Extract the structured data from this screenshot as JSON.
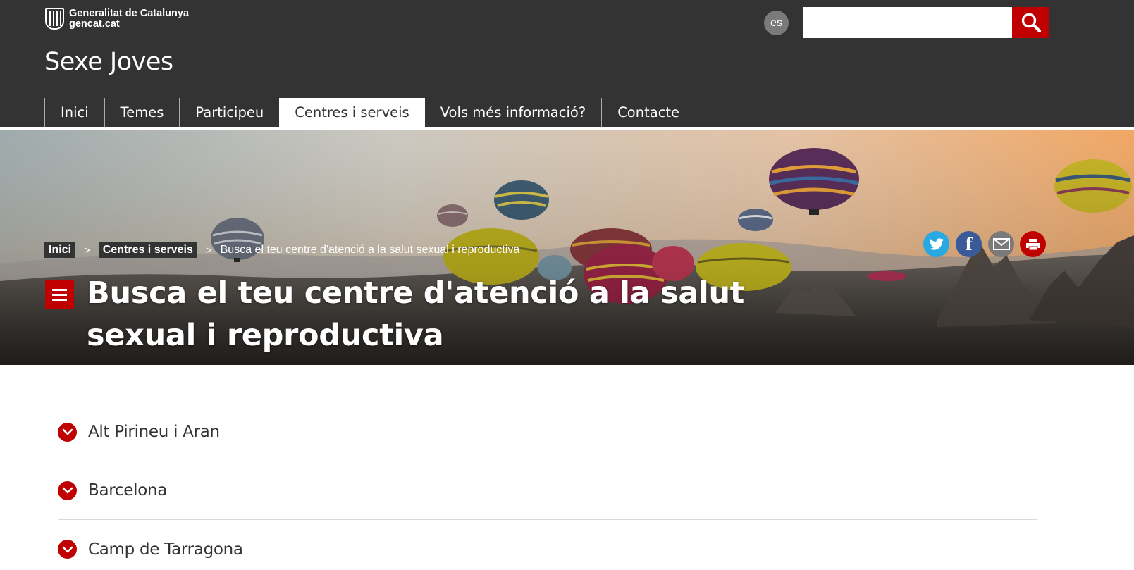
{
  "header": {
    "logo": {
      "line1": "Generalitat de Catalunya",
      "line2": "gencat.cat"
    },
    "language_button": "es",
    "search": {
      "value": "",
      "placeholder": ""
    },
    "site_title": "Sexe Joves"
  },
  "nav": {
    "items": [
      {
        "label": "Inici"
      },
      {
        "label": "Temes"
      },
      {
        "label": "Participeu"
      },
      {
        "label": "Centres i serveis",
        "active": true
      },
      {
        "label": "Vols més informació?"
      },
      {
        "label": "Contacte"
      }
    ]
  },
  "breadcrumb": {
    "items": [
      "Inici",
      "Centres i serveis"
    ],
    "separator": ">",
    "current": "Busca el teu centre d'atenció a la salut sexual i reproductiva"
  },
  "share": {
    "icons": [
      "twitter-icon",
      "facebook-icon",
      "email-icon",
      "print-icon"
    ]
  },
  "page": {
    "title": "Busca el teu centre d'atenció a la salut sexual i reproductiva"
  },
  "accordion": {
    "items": [
      {
        "label": "Alt Pirineu i Aran"
      },
      {
        "label": "Barcelona"
      },
      {
        "label": "Camp de Tarragona"
      }
    ]
  },
  "colors": {
    "header_bg": "#333333",
    "accent_red": "#c00000",
    "twitter_blue": "#29a9e1",
    "facebook_blue": "#3b5a9a",
    "email_gray": "#7a7a7a"
  }
}
